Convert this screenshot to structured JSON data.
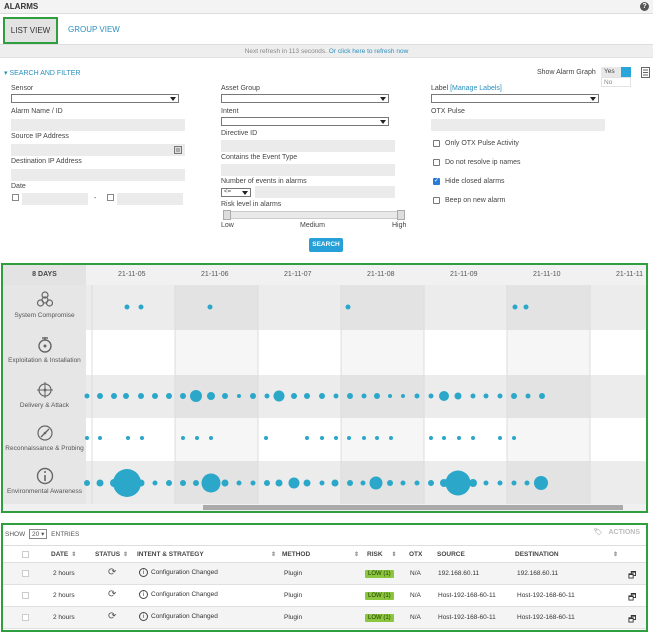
{
  "app": {
    "title": "ALARMS",
    "help_icon": "?"
  },
  "tabs": {
    "list": "LIST VIEW",
    "group": "GROUP VIEW"
  },
  "refresh": {
    "text": "Next refresh in 113 seconds.",
    "link": "Or click here to refresh now"
  },
  "filters": {
    "toggle_label": "SEARCH AND FILTER",
    "show_graph_label": "Show Alarm Graph",
    "show_graph_yes": "Yes",
    "show_graph_no": "No",
    "sensor": "Sensor",
    "alarm_name": "Alarm Name / ID",
    "source_ip": "Source IP Address",
    "dest_ip": "Destination IP Address",
    "date": "Date",
    "date_sep": "-",
    "asset_group": "Asset Group",
    "intent": "Intent",
    "directive_id": "Directive ID",
    "event_type": "Contains the Event Type",
    "num_events": "Number of events in alarms",
    "num_events_op": "<=",
    "risk_level": "Risk level in alarms",
    "risk_low": "Low",
    "risk_medium": "Medium",
    "risk_high": "High",
    "label": "Label",
    "manage_labels": "[Manage Labels]",
    "otx_pulse": "OTX Pulse",
    "only_otx": "Only OTX Pulse Activity",
    "no_resolve": "Do not resolve ip names",
    "hide_closed": "Hide closed alarms",
    "beep": "Beep on new alarm",
    "search_button": "SEARCH"
  },
  "graph": {
    "days_label": "8 DAYS",
    "dates": [
      "21-11-05",
      "21-11-06",
      "21-11-07",
      "21-11-08",
      "21-11-09",
      "21-11-10",
      "21-11-11"
    ],
    "rows": [
      {
        "label": "System Compromise",
        "icon": "biohazard-icon"
      },
      {
        "label": "Exploitation & Installation",
        "icon": "bomb-icon"
      },
      {
        "label": "Delivery & Attack",
        "icon": "crosshair-icon"
      },
      {
        "label": "Reconnaissance & Probing",
        "icon": "compass-icon"
      },
      {
        "label": "Environmental Awareness",
        "icon": "info-icon"
      }
    ],
    "dot_color": "#2aa7c9"
  },
  "table": {
    "show": "SHOW",
    "entries_value": "20",
    "entries": "ENTRIES",
    "actions": "ACTIONS",
    "headers": [
      "DATE",
      "STATUS",
      "INTENT & STRATEGY",
      "METHOD",
      "RISK",
      "OTX",
      "SOURCE",
      "DESTINATION"
    ],
    "rows": [
      {
        "date": "2 hours",
        "intent": "Configuration Changed",
        "method": "Plugin",
        "risk": "LOW (1)",
        "otx": "N/A",
        "source": "192.168.60.11",
        "destination": "192.168.60.11"
      },
      {
        "date": "2 hours",
        "intent": "Configuration Changed",
        "method": "Plugin",
        "risk": "LOW (1)",
        "otx": "N/A",
        "source": "Host-192-168-60-11",
        "destination": "Host-192-168-60-11"
      },
      {
        "date": "2 hours",
        "intent": "Configuration Changed",
        "method": "Plugin",
        "risk": "LOW (1)",
        "otx": "N/A",
        "source": "Host-192-168-60-11",
        "destination": "Host-192-168-60-11"
      }
    ]
  }
}
